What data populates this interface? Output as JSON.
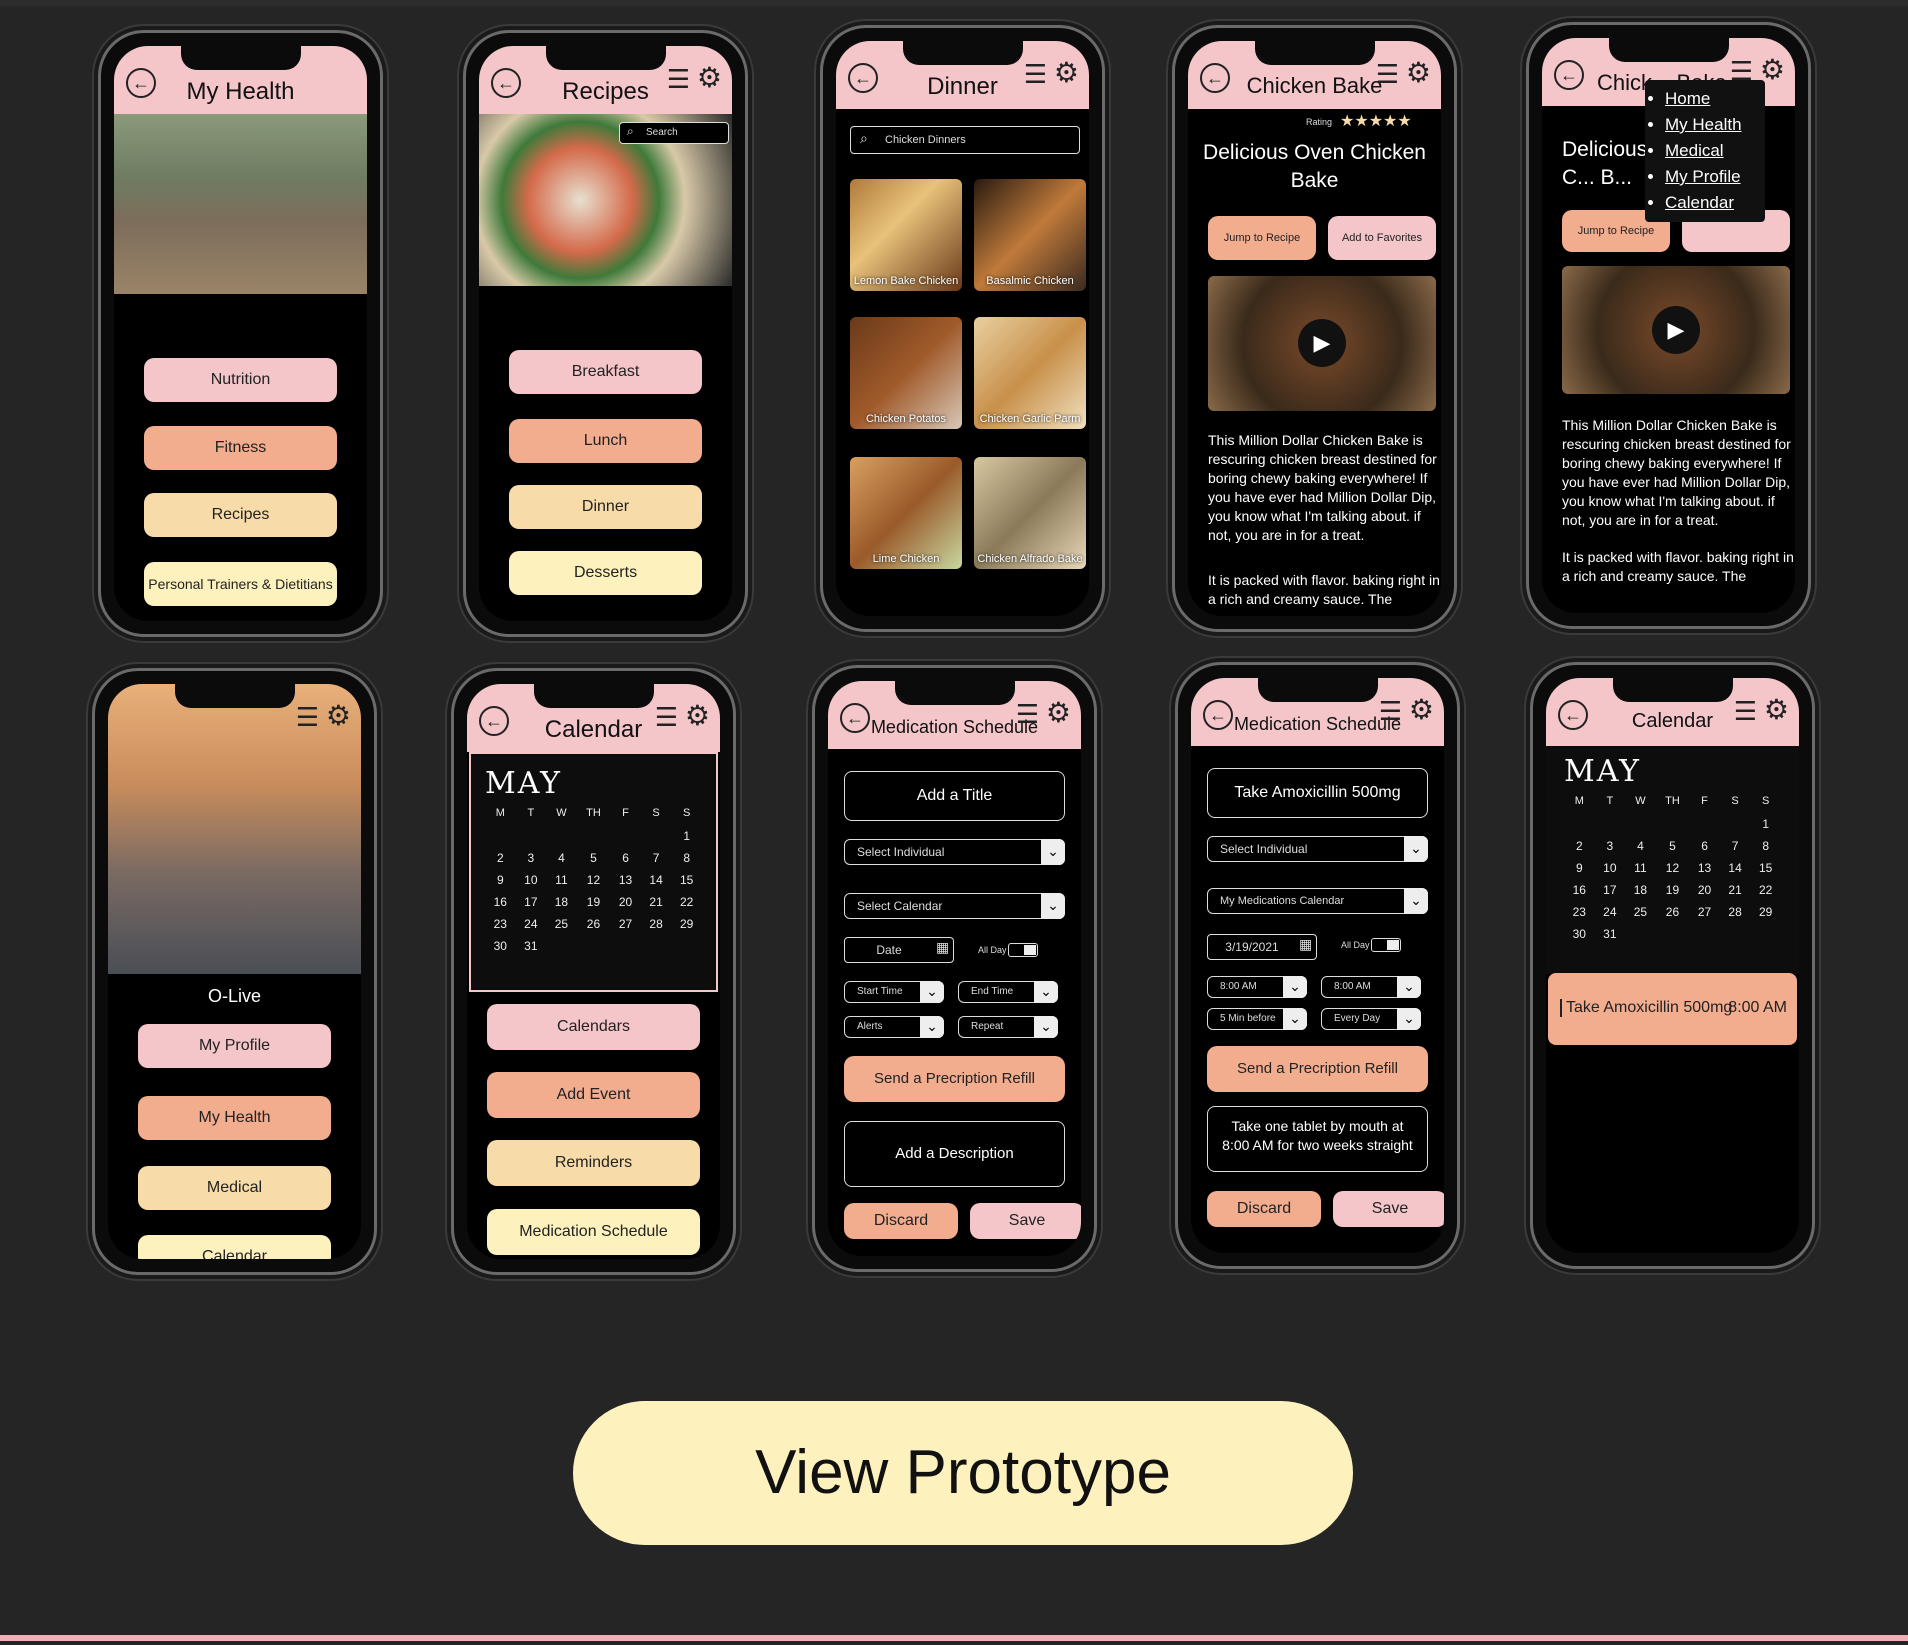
{
  "health": {
    "title": "My Health",
    "buttons": [
      "Nutrition",
      "Fitness",
      "Recipes",
      "Personal Trainers & Dietitians"
    ]
  },
  "recipes": {
    "title": "Recipes",
    "search": "Search",
    "buttons": [
      "Breakfast",
      "Lunch",
      "Dinner",
      "Desserts"
    ]
  },
  "dinner": {
    "title": "Dinner",
    "search": "Chicken Dinners",
    "items": [
      "Lemon Bake Chicken",
      "Basalmic Chicken",
      "Chicken Potatos",
      "Chicken Garlic Parm",
      "Lime Chicken",
      "Chicken Alfrado Bake"
    ]
  },
  "bake": {
    "title": "Chicken Bake",
    "rating_label": "Rating",
    "stars": "★★★★★",
    "heading": "Delicious Oven Chicken Bake",
    "jump": "Jump to Recipe",
    "fav": "Add to Favorites",
    "p1": "This Million Dollar Chicken Bake is rescuring chicken breast destined for boring chewy baking everywhere! If you have ever had Million Dollar Dip, you know what I'm talking about. if not, you are in for a treat.",
    "p2": "It is packed with flavor. baking right in a rich and creamy sauce. The"
  },
  "bake2": {
    "title": "Chick... Bake",
    "heading": "Delicious C... B...",
    "jump": "Jump to Recipe",
    "menu": [
      "Home",
      "My Health",
      "Medical",
      "My Profile",
      "Calendar"
    ],
    "p1": "This Million Dollar Chicken Bake is rescuring chicken breast destined for boring chewy baking everywhere! If you have ever had Million Dollar Dip, you know what I'm talking about. if not, you are in for a treat.",
    "p2": "It is packed with flavor. baking right in a rich and creamy sauce. The"
  },
  "home": {
    "name": "O-Live",
    "buttons": [
      "My Profile",
      "My Health",
      "Medical",
      "Calendar"
    ]
  },
  "calendar": {
    "title": "Calendar",
    "month": "MAY",
    "days": [
      "M",
      "T",
      "W",
      "TH",
      "F",
      "S",
      "S"
    ],
    "weeks": [
      [
        "",
        "",
        "",
        "",
        "",
        "",
        "1"
      ],
      [
        "2",
        "3",
        "4",
        "5",
        "6",
        "7",
        "8"
      ],
      [
        "9",
        "10",
        "11",
        "12",
        "13",
        "14",
        "15"
      ],
      [
        "16",
        "17",
        "18",
        "19",
        "20",
        "21",
        "22"
      ],
      [
        "23",
        "24",
        "25",
        "26",
        "27",
        "28",
        "29"
      ],
      [
        "30",
        "31",
        "",
        "",
        "",
        "",
        ""
      ]
    ],
    "buttons": [
      "Calendars",
      "Add Event",
      "Reminders",
      "Medication Schedule"
    ]
  },
  "med1": {
    "title": "Medication Schedule",
    "add_title": "Add a Title",
    "individual": "Select Individual",
    "calendar": "Select Calendar",
    "date": "Date",
    "allday": "All Day",
    "start": "Start Time",
    "end": "End Time",
    "alerts": "Alerts",
    "repeat": "Repeat",
    "refill": "Send a Precription Refill",
    "desc": "Add a Description",
    "discard": "Discard",
    "save": "Save"
  },
  "med2": {
    "title": "Medication Schedule",
    "add_title": "Take Amoxicillin 500mg",
    "individual": "Select Individual",
    "calendar": "My Medications Calendar",
    "date": "3/19/2021",
    "allday": "All Day",
    "start": "8:00 AM",
    "end": "8:00 AM",
    "alerts": "5 Min before",
    "repeat": "Every Day",
    "refill": "Send a Precription Refill",
    "desc": "Take one tablet by mouth at 8:00 AM for two weeks straight",
    "discard": "Discard",
    "save": "Save"
  },
  "calendar2": {
    "title": "Calendar",
    "month": "MAY",
    "event": "Take Amoxicillin 500mg",
    "event_time": "8:00 AM"
  },
  "cta": "View Prototype"
}
